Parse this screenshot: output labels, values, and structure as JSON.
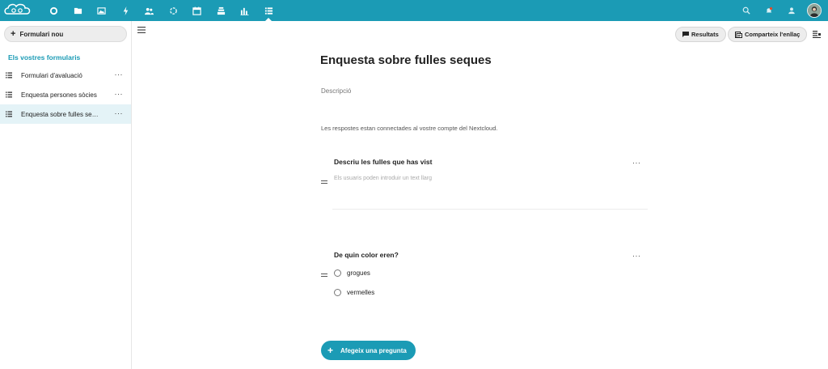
{
  "colors": {
    "primary": "#1b9bb5",
    "sidebar_active": "#e4f3f7"
  },
  "topbar": {
    "apps": [
      {
        "name": "dashboard-icon"
      },
      {
        "name": "files-icon"
      },
      {
        "name": "photos-icon"
      },
      {
        "name": "activity-icon"
      },
      {
        "name": "contacts-icon"
      },
      {
        "name": "circles-icon"
      },
      {
        "name": "calendar-icon"
      },
      {
        "name": "deck-icon"
      },
      {
        "name": "analytics-icon"
      },
      {
        "name": "forms-icon",
        "active": true
      }
    ],
    "right": [
      "search-icon",
      "notifications-icon",
      "contacts-menu-icon",
      "avatar"
    ]
  },
  "sidebar": {
    "new_button_label": "Formulari nou",
    "caption": "Els vostres formularis",
    "items": [
      {
        "label": "Formulari d'avaluació"
      },
      {
        "label": "Enquesta persones sòcies"
      },
      {
        "label": "Enquesta sobre fulles se…",
        "active": true
      }
    ],
    "more_label": "···"
  },
  "header": {
    "results_label": "Resultats",
    "share_label": "Comparteix l'enllaç"
  },
  "form": {
    "title": "Enquesta sobre fulles seques",
    "description": "Descripció",
    "notice": "Les respostes estan connectades al vostre compte del Nextcloud.",
    "questions": [
      {
        "title": "Descriu les fulles que has vist",
        "placeholder": "Els usuaris poden introduir un text llarg"
      },
      {
        "title": "De quin color eren?",
        "options": [
          "grogues",
          "vermelles"
        ]
      }
    ],
    "more_label": "···",
    "add_question_label": "Afegeix una pregunta"
  }
}
